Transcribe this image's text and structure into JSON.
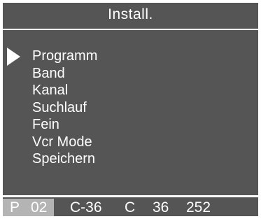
{
  "title": "Install.",
  "menu": {
    "items": [
      {
        "label": "Programm",
        "selected": true
      },
      {
        "label": "Band",
        "selected": false
      },
      {
        "label": "Kanal",
        "selected": false
      },
      {
        "label": "Suchlauf",
        "selected": false
      },
      {
        "label": "Fein",
        "selected": false
      },
      {
        "label": "Vcr Mode",
        "selected": false
      },
      {
        "label": "Speichern",
        "selected": false
      }
    ]
  },
  "status": {
    "prog_label": "P",
    "prog_number": "02",
    "channel": "C-36",
    "band": "C",
    "channel_number": "36",
    "fine_value": "252"
  },
  "colors": {
    "background": "#555555",
    "text": "#ffffff",
    "highlight": "#b4b4b4"
  },
  "icons": {
    "selection_pointer": "triangle-right-icon"
  }
}
